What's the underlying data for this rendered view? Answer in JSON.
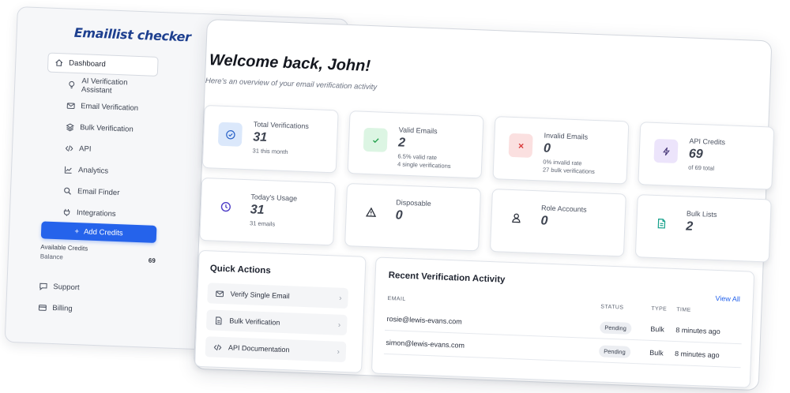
{
  "app": {
    "brand": "Emaillist checker"
  },
  "sidebar": {
    "items": [
      {
        "label": "Dashboard",
        "icon": "home-icon",
        "active": true
      },
      {
        "label": "AI Verification Assistant",
        "icon": "lightbulb-icon"
      },
      {
        "label": "Email Verification",
        "icon": "envelope-icon"
      },
      {
        "label": "Bulk Verification",
        "icon": "layers-icon"
      },
      {
        "label": "API",
        "icon": "code-icon"
      },
      {
        "label": "Analytics",
        "icon": "chart-icon"
      },
      {
        "label": "Email Finder",
        "icon": "search-icon"
      },
      {
        "label": "Integrations",
        "icon": "plug-icon"
      }
    ],
    "add_credits_label": "Add Credits",
    "credits": {
      "title": "Available Credits",
      "balance_label": "Balance",
      "balance_value": "69"
    },
    "bottom_items": [
      {
        "label": "Support",
        "icon": "chat-icon"
      },
      {
        "label": "Billing",
        "icon": "card-icon"
      }
    ]
  },
  "main": {
    "welcome": "Welcome back, John!",
    "overview": "Here's an overview of your email verification activity",
    "stats": [
      {
        "label": "Total Verifications",
        "value": "31",
        "sub1": "31 this month",
        "sub2": ""
      },
      {
        "label": "Valid Emails",
        "value": "2",
        "sub1": "6.5% valid rate",
        "sub2": "4 single verifications"
      },
      {
        "label": "Invalid Emails",
        "value": "0",
        "sub1": "0% invalid rate",
        "sub2": "27 bulk verifications"
      },
      {
        "label": "API Credits",
        "value": "69",
        "sub1": "of 69 total",
        "sub2": ""
      },
      {
        "label": "Today's Usage",
        "value": "31",
        "sub1": "31 emails",
        "sub2": ""
      },
      {
        "label": "Disposable",
        "value": "0",
        "sub1": "",
        "sub2": ""
      },
      {
        "label": "Role Accounts",
        "value": "0",
        "sub1": "",
        "sub2": ""
      },
      {
        "label": "Bulk Lists",
        "value": "2",
        "sub1": "",
        "sub2": ""
      }
    ],
    "quick_actions": {
      "title": "Quick Actions",
      "items": [
        {
          "label": "Verify Single Email",
          "icon": "envelope-icon"
        },
        {
          "label": "Bulk Verification",
          "icon": "document-icon"
        },
        {
          "label": "API Documentation",
          "icon": "code-icon"
        }
      ]
    },
    "recent": {
      "title": "Recent Verification Activity",
      "view_all": "View All",
      "headers": {
        "email": "EMAIL",
        "status": "STATUS",
        "type": "TYPE",
        "time": "TIME"
      },
      "rows": [
        {
          "email": "rosie@lewis-evans.com",
          "status": "Pending",
          "type": "Bulk",
          "time": "8 minutes ago"
        },
        {
          "email": "simon@lewis-evans.com",
          "status": "Pending",
          "type": "Bulk",
          "time": "8 minutes ago"
        }
      ]
    }
  },
  "colors": {
    "accent": "#2563eb",
    "valid_bg": "#dcf5e3",
    "valid_fg": "#22a04b",
    "invalid_bg": "#fbe0e0",
    "invalid_fg": "#d93c3c",
    "total_bg": "#dbe8fb",
    "total_fg": "#2a63c8",
    "api_bg": "#ece4fb",
    "api_fg": "#4a3a7a"
  }
}
